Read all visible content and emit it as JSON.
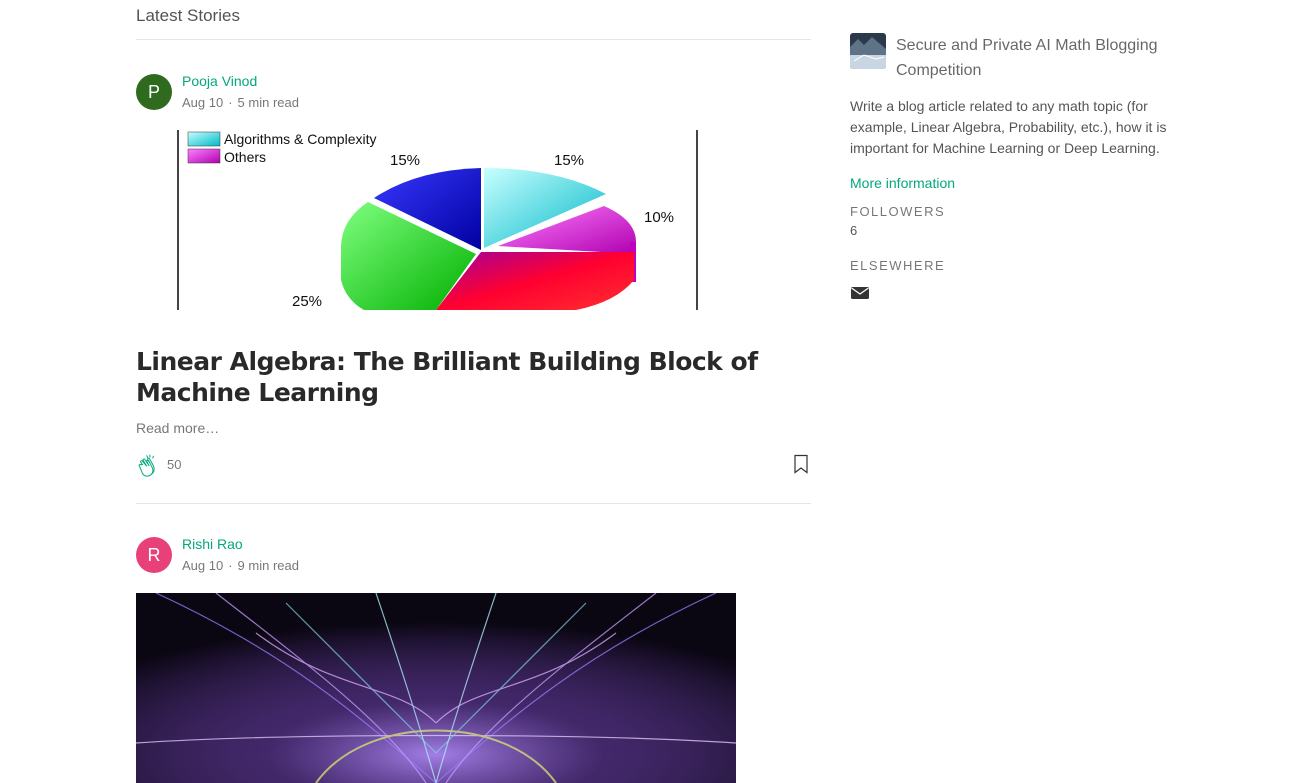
{
  "section": {
    "title": "Latest Stories"
  },
  "posts": [
    {
      "author": "Pooja Vinod",
      "avatar_letter": "P",
      "avatar_color": "#2e6b1f",
      "date": "Aug 10",
      "read_time": "5 min read",
      "title": "Linear Algebra: The Brilliant Building Block of Machine Learning",
      "read_more": "Read more…",
      "claps": "50",
      "image": {
        "legend": [
          "Algorithms & Complexity",
          "Others"
        ],
        "labels": [
          "15%",
          "15%",
          "10%",
          "25%"
        ]
      }
    },
    {
      "author": "Rishi Rao",
      "avatar_letter": "R",
      "avatar_color": "#e8417a",
      "date": "Aug 10",
      "read_time": "9 min read"
    }
  ],
  "sidebar": {
    "publication_name": "Secure and Private AI Math Blogging Competition",
    "description": "Write a blog article related to any math topic (for example, Linear Algebra, Probability, etc.), how it is important for Machine Learning or Deep Learning.",
    "more_info": "More information",
    "followers_label": "Followers",
    "followers_count": "6",
    "elsewhere_label": "Elsewhere",
    "elsewhere_icon": "mail-icon"
  },
  "colors": {
    "accent": "#03a87c"
  }
}
